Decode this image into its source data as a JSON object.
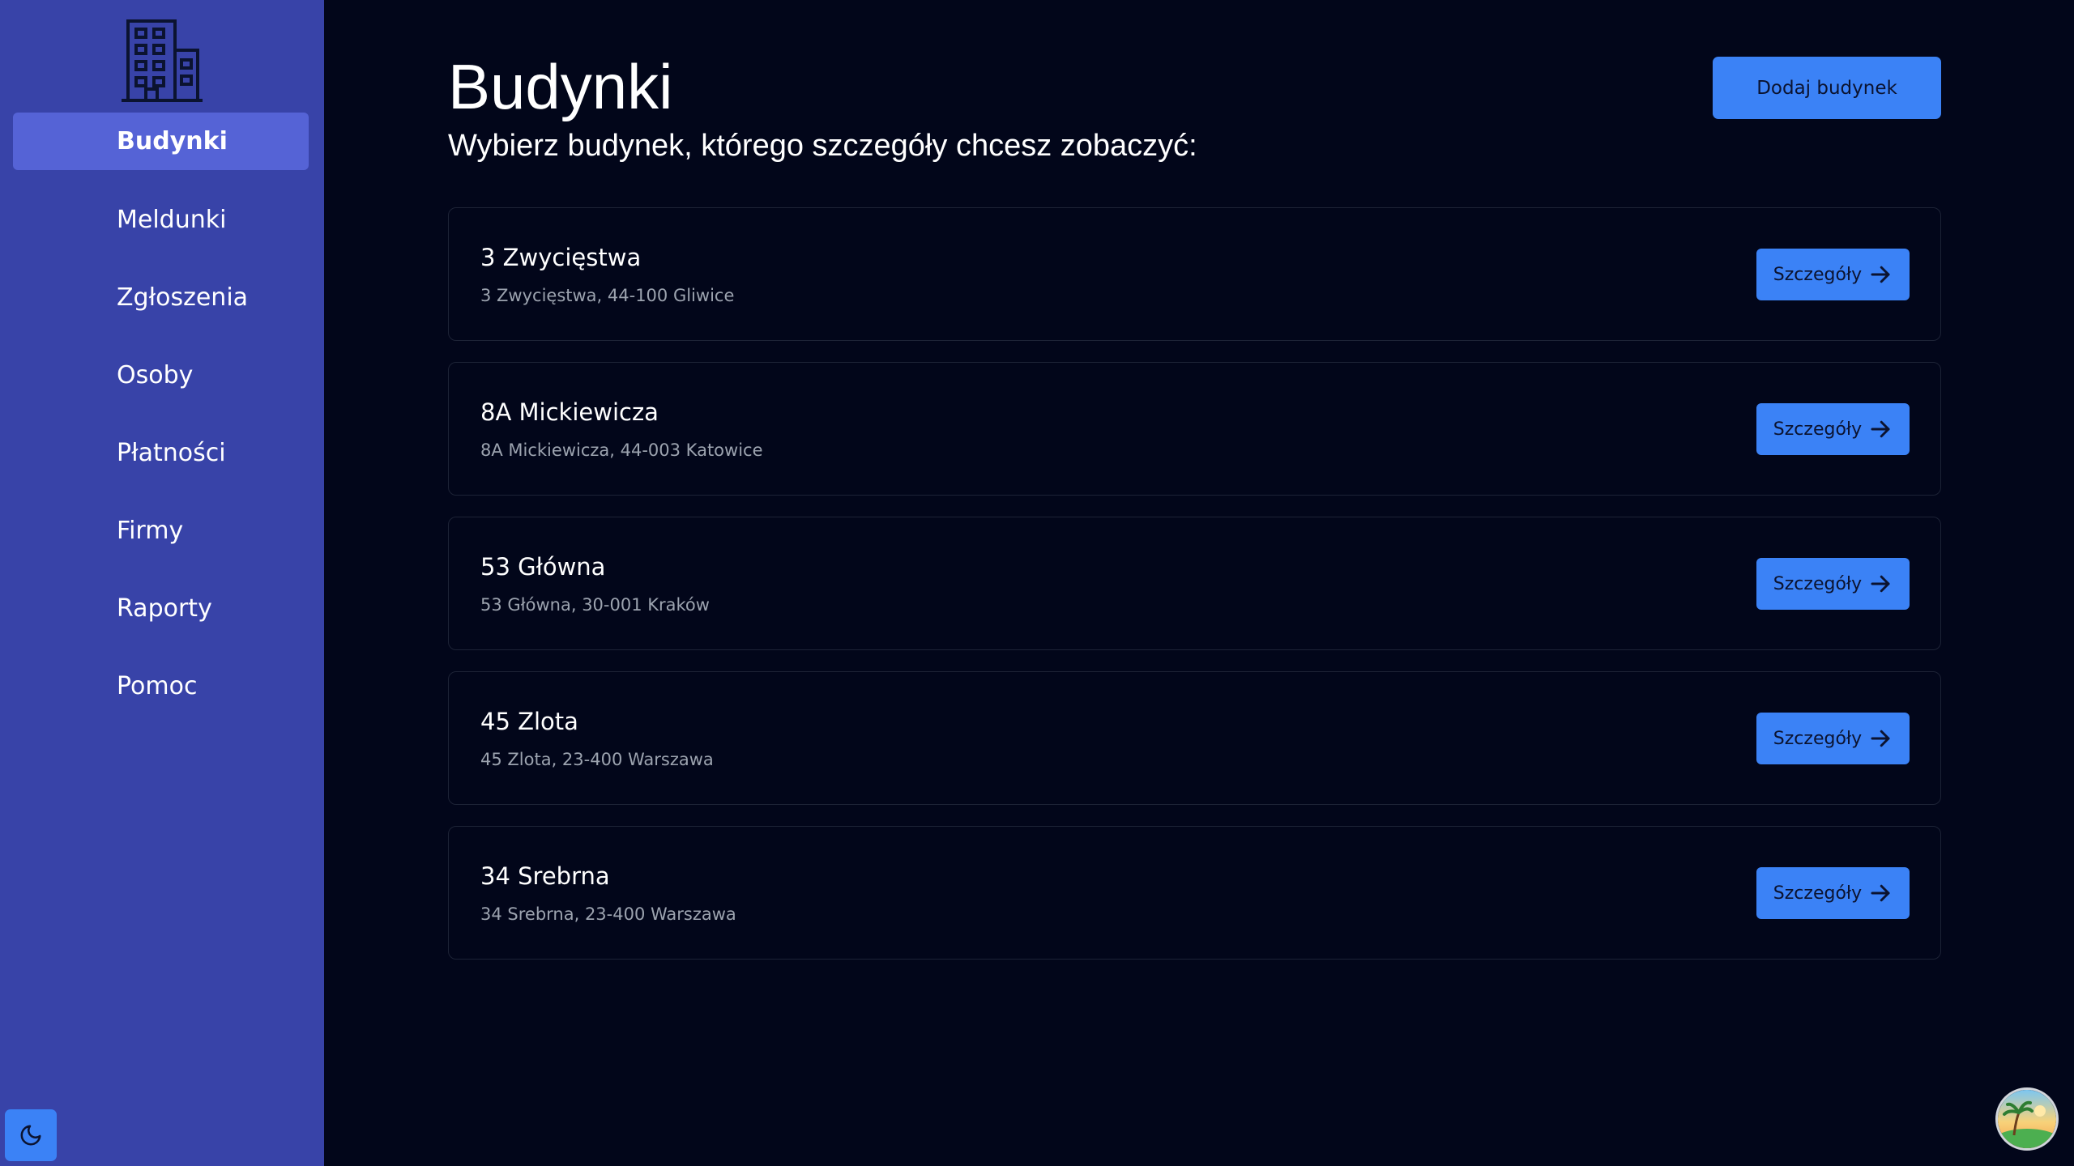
{
  "sidebar": {
    "items": [
      {
        "label": "Budynki",
        "active": true
      },
      {
        "label": "Meldunki",
        "active": false
      },
      {
        "label": "Zgłoszenia",
        "active": false
      },
      {
        "label": "Osoby",
        "active": false
      },
      {
        "label": "Płatności",
        "active": false
      },
      {
        "label": "Firmy",
        "active": false
      },
      {
        "label": "Raporty",
        "active": false
      },
      {
        "label": "Pomoc",
        "active": false
      }
    ],
    "logo_icon": "building-icon",
    "theme_icon": "moon-icon"
  },
  "main": {
    "title": "Budynki",
    "subtitle": "Wybierz budynek, którego szczegóły chcesz zobaczyć:",
    "add_button_label": "Dodaj budynek",
    "buildings": [
      {
        "name": "3 Zwycięstwa",
        "address": "3 Zwycięstwa, 44-100 Gliwice"
      },
      {
        "name": "8A Mickiewicza",
        "address": "8A Mickiewicza, 44-003 Katowice"
      },
      {
        "name": "53 Główna",
        "address": "53 Główna, 30-001 Kraków"
      },
      {
        "name": "45 Zlota",
        "address": "45 Zlota, 23-400 Warszawa"
      },
      {
        "name": "34 Srebrna",
        "address": "34 Srebrna, 23-400 Warszawa"
      }
    ],
    "details_label": "Szczegóły",
    "details_icon": "arrow-right-icon"
  },
  "colors": {
    "sidebar_bg": "#3843a8",
    "sidebar_active": "#5563d6",
    "main_bg": "#02061a",
    "accent": "#3b82f6"
  }
}
